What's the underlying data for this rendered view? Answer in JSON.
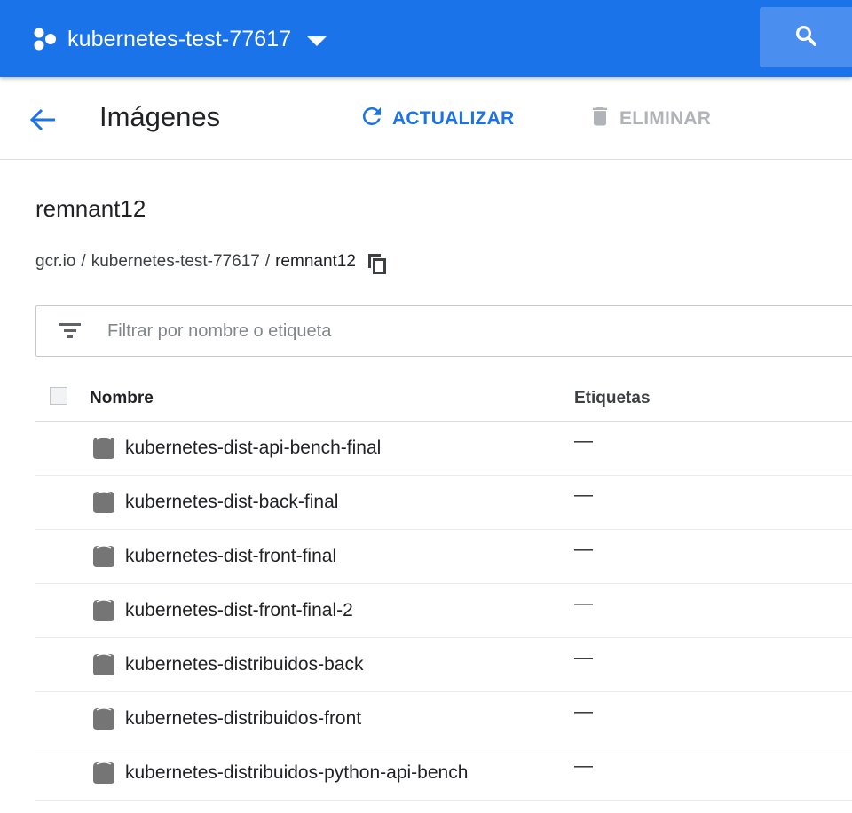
{
  "topbar": {
    "project_name": "kubernetes-test-77617",
    "icons": {
      "project": "project-dots-icon",
      "dropdown": "caret-down-icon",
      "search": "search-icon"
    },
    "color": "#1a73e8"
  },
  "header": {
    "title": "Imágenes",
    "refresh_label": "ACTUALIZAR",
    "delete_label": "ELIMINAR",
    "icons": {
      "back": "arrow-back-icon",
      "refresh": "refresh-icon",
      "delete": "trash-icon"
    }
  },
  "repository": {
    "name": "remnant12",
    "breadcrumb": {
      "host": "gcr.io",
      "separator": "/",
      "project": "kubernetes-test-77617",
      "repo": "remnant12"
    },
    "copy_icon": "copy-icon"
  },
  "filter": {
    "placeholder": "Filtrar por nombre o etiqueta",
    "value": "",
    "icon": "filter-list-icon"
  },
  "table": {
    "columns": {
      "name": "Nombre",
      "tags": "Etiquetas"
    },
    "rows": [
      {
        "name": "kubernetes-dist-api-bench-final",
        "tags": "—"
      },
      {
        "name": "kubernetes-dist-back-final",
        "tags": "—"
      },
      {
        "name": "kubernetes-dist-front-final",
        "tags": "—"
      },
      {
        "name": "kubernetes-dist-front-final-2",
        "tags": "—"
      },
      {
        "name": "kubernetes-distribuidos-back",
        "tags": "—"
      },
      {
        "name": "kubernetes-distribuidos-front",
        "tags": "—"
      },
      {
        "name": "kubernetes-distribuidos-python-api-bench",
        "tags": "—"
      }
    ],
    "row_icon": "image-icon"
  }
}
